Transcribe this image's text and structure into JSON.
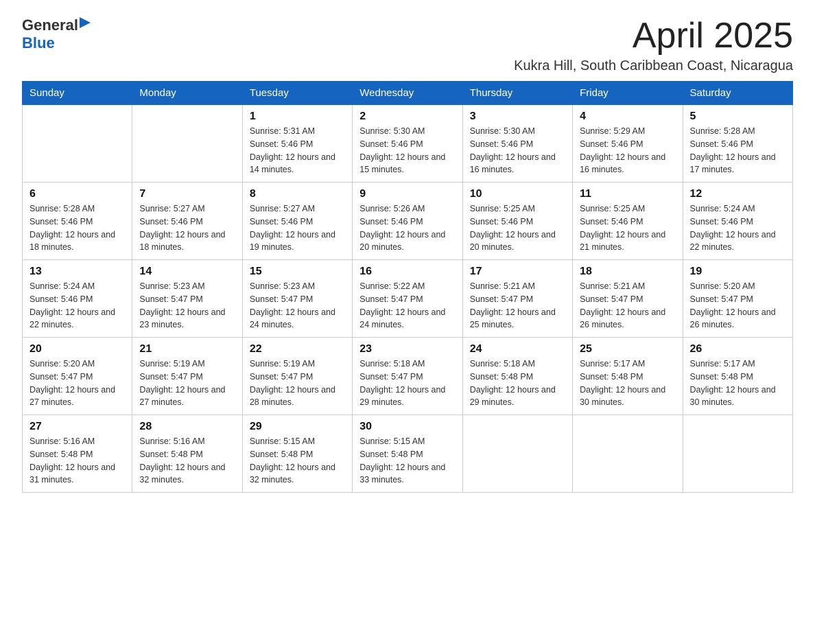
{
  "header": {
    "logo_general": "General",
    "logo_blue": "Blue",
    "title": "April 2025",
    "location": "Kukra Hill, South Caribbean Coast, Nicaragua"
  },
  "weekdays": [
    "Sunday",
    "Monday",
    "Tuesday",
    "Wednesday",
    "Thursday",
    "Friday",
    "Saturday"
  ],
  "weeks": [
    [
      {
        "day": "",
        "sunrise": "",
        "sunset": "",
        "daylight": ""
      },
      {
        "day": "",
        "sunrise": "",
        "sunset": "",
        "daylight": ""
      },
      {
        "day": "1",
        "sunrise": "Sunrise: 5:31 AM",
        "sunset": "Sunset: 5:46 PM",
        "daylight": "Daylight: 12 hours and 14 minutes."
      },
      {
        "day": "2",
        "sunrise": "Sunrise: 5:30 AM",
        "sunset": "Sunset: 5:46 PM",
        "daylight": "Daylight: 12 hours and 15 minutes."
      },
      {
        "day": "3",
        "sunrise": "Sunrise: 5:30 AM",
        "sunset": "Sunset: 5:46 PM",
        "daylight": "Daylight: 12 hours and 16 minutes."
      },
      {
        "day": "4",
        "sunrise": "Sunrise: 5:29 AM",
        "sunset": "Sunset: 5:46 PM",
        "daylight": "Daylight: 12 hours and 16 minutes."
      },
      {
        "day": "5",
        "sunrise": "Sunrise: 5:28 AM",
        "sunset": "Sunset: 5:46 PM",
        "daylight": "Daylight: 12 hours and 17 minutes."
      }
    ],
    [
      {
        "day": "6",
        "sunrise": "Sunrise: 5:28 AM",
        "sunset": "Sunset: 5:46 PM",
        "daylight": "Daylight: 12 hours and 18 minutes."
      },
      {
        "day": "7",
        "sunrise": "Sunrise: 5:27 AM",
        "sunset": "Sunset: 5:46 PM",
        "daylight": "Daylight: 12 hours and 18 minutes."
      },
      {
        "day": "8",
        "sunrise": "Sunrise: 5:27 AM",
        "sunset": "Sunset: 5:46 PM",
        "daylight": "Daylight: 12 hours and 19 minutes."
      },
      {
        "day": "9",
        "sunrise": "Sunrise: 5:26 AM",
        "sunset": "Sunset: 5:46 PM",
        "daylight": "Daylight: 12 hours and 20 minutes."
      },
      {
        "day": "10",
        "sunrise": "Sunrise: 5:25 AM",
        "sunset": "Sunset: 5:46 PM",
        "daylight": "Daylight: 12 hours and 20 minutes."
      },
      {
        "day": "11",
        "sunrise": "Sunrise: 5:25 AM",
        "sunset": "Sunset: 5:46 PM",
        "daylight": "Daylight: 12 hours and 21 minutes."
      },
      {
        "day": "12",
        "sunrise": "Sunrise: 5:24 AM",
        "sunset": "Sunset: 5:46 PM",
        "daylight": "Daylight: 12 hours and 22 minutes."
      }
    ],
    [
      {
        "day": "13",
        "sunrise": "Sunrise: 5:24 AM",
        "sunset": "Sunset: 5:46 PM",
        "daylight": "Daylight: 12 hours and 22 minutes."
      },
      {
        "day": "14",
        "sunrise": "Sunrise: 5:23 AM",
        "sunset": "Sunset: 5:47 PM",
        "daylight": "Daylight: 12 hours and 23 minutes."
      },
      {
        "day": "15",
        "sunrise": "Sunrise: 5:23 AM",
        "sunset": "Sunset: 5:47 PM",
        "daylight": "Daylight: 12 hours and 24 minutes."
      },
      {
        "day": "16",
        "sunrise": "Sunrise: 5:22 AM",
        "sunset": "Sunset: 5:47 PM",
        "daylight": "Daylight: 12 hours and 24 minutes."
      },
      {
        "day": "17",
        "sunrise": "Sunrise: 5:21 AM",
        "sunset": "Sunset: 5:47 PM",
        "daylight": "Daylight: 12 hours and 25 minutes."
      },
      {
        "day": "18",
        "sunrise": "Sunrise: 5:21 AM",
        "sunset": "Sunset: 5:47 PM",
        "daylight": "Daylight: 12 hours and 26 minutes."
      },
      {
        "day": "19",
        "sunrise": "Sunrise: 5:20 AM",
        "sunset": "Sunset: 5:47 PM",
        "daylight": "Daylight: 12 hours and 26 minutes."
      }
    ],
    [
      {
        "day": "20",
        "sunrise": "Sunrise: 5:20 AM",
        "sunset": "Sunset: 5:47 PM",
        "daylight": "Daylight: 12 hours and 27 minutes."
      },
      {
        "day": "21",
        "sunrise": "Sunrise: 5:19 AM",
        "sunset": "Sunset: 5:47 PM",
        "daylight": "Daylight: 12 hours and 27 minutes."
      },
      {
        "day": "22",
        "sunrise": "Sunrise: 5:19 AM",
        "sunset": "Sunset: 5:47 PM",
        "daylight": "Daylight: 12 hours and 28 minutes."
      },
      {
        "day": "23",
        "sunrise": "Sunrise: 5:18 AM",
        "sunset": "Sunset: 5:47 PM",
        "daylight": "Daylight: 12 hours and 29 minutes."
      },
      {
        "day": "24",
        "sunrise": "Sunrise: 5:18 AM",
        "sunset": "Sunset: 5:48 PM",
        "daylight": "Daylight: 12 hours and 29 minutes."
      },
      {
        "day": "25",
        "sunrise": "Sunrise: 5:17 AM",
        "sunset": "Sunset: 5:48 PM",
        "daylight": "Daylight: 12 hours and 30 minutes."
      },
      {
        "day": "26",
        "sunrise": "Sunrise: 5:17 AM",
        "sunset": "Sunset: 5:48 PM",
        "daylight": "Daylight: 12 hours and 30 minutes."
      }
    ],
    [
      {
        "day": "27",
        "sunrise": "Sunrise: 5:16 AM",
        "sunset": "Sunset: 5:48 PM",
        "daylight": "Daylight: 12 hours and 31 minutes."
      },
      {
        "day": "28",
        "sunrise": "Sunrise: 5:16 AM",
        "sunset": "Sunset: 5:48 PM",
        "daylight": "Daylight: 12 hours and 32 minutes."
      },
      {
        "day": "29",
        "sunrise": "Sunrise: 5:15 AM",
        "sunset": "Sunset: 5:48 PM",
        "daylight": "Daylight: 12 hours and 32 minutes."
      },
      {
        "day": "30",
        "sunrise": "Sunrise: 5:15 AM",
        "sunset": "Sunset: 5:48 PM",
        "daylight": "Daylight: 12 hours and 33 minutes."
      },
      {
        "day": "",
        "sunrise": "",
        "sunset": "",
        "daylight": ""
      },
      {
        "day": "",
        "sunrise": "",
        "sunset": "",
        "daylight": ""
      },
      {
        "day": "",
        "sunrise": "",
        "sunset": "",
        "daylight": ""
      }
    ]
  ]
}
